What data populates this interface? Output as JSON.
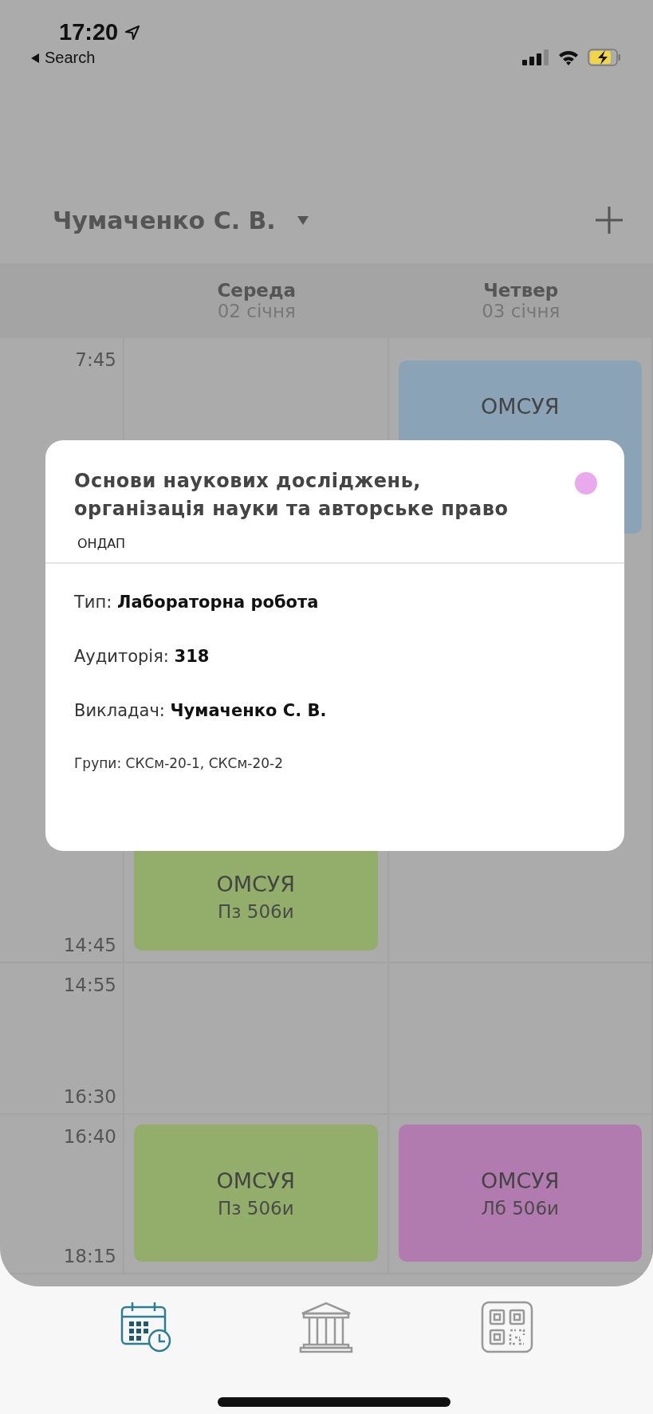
{
  "status_bar": {
    "time": "17:20",
    "back_label": "Search"
  },
  "header": {
    "teacher": "Чумаченко С. В."
  },
  "days": [
    {
      "name": "Середа",
      "date": "02 січня"
    },
    {
      "name": "Четвер",
      "date": "03 січня"
    }
  ],
  "slots": [
    {
      "start": "7:45",
      "end": "14:45",
      "cells": [
        {
          "title": "ОМСУЯ",
          "subtitle": "Пз 506и",
          "color": "#93ad6b",
          "kind": "end"
        },
        {
          "title": "ОМСУЯ",
          "color": "#8aa3b6",
          "kind": "start"
        }
      ]
    },
    {
      "start": "14:55",
      "end": "16:30",
      "cells": [
        null,
        null
      ]
    },
    {
      "start": "16:40",
      "end": "18:15",
      "cells": [
        {
          "title": "ОМСУЯ",
          "subtitle": "Пз 506и",
          "color": "#93ad6b",
          "kind": "fill"
        },
        {
          "title": "ОМСУЯ",
          "subtitle": "Лб 506и",
          "color": "#b17bb0",
          "kind": "fill"
        }
      ]
    }
  ],
  "popup": {
    "title": "Основи наукових досліджень, організація науки та авторське право",
    "code": "ОНДАП",
    "color": "#eaa9ec",
    "fields": [
      {
        "label": "Тип:",
        "value": "Лабораторна робота"
      },
      {
        "label": "Аудиторія:",
        "value": "318"
      },
      {
        "label": "Викладач:",
        "value": "Чумаченко С. В."
      }
    ],
    "groups": "Групи: СКСм-20-1, СКСм-20-2"
  },
  "tab_bar": [
    {
      "kind": "calendar",
      "selected": true
    },
    {
      "kind": "building",
      "selected": false
    },
    {
      "kind": "qr",
      "selected": false
    }
  ]
}
